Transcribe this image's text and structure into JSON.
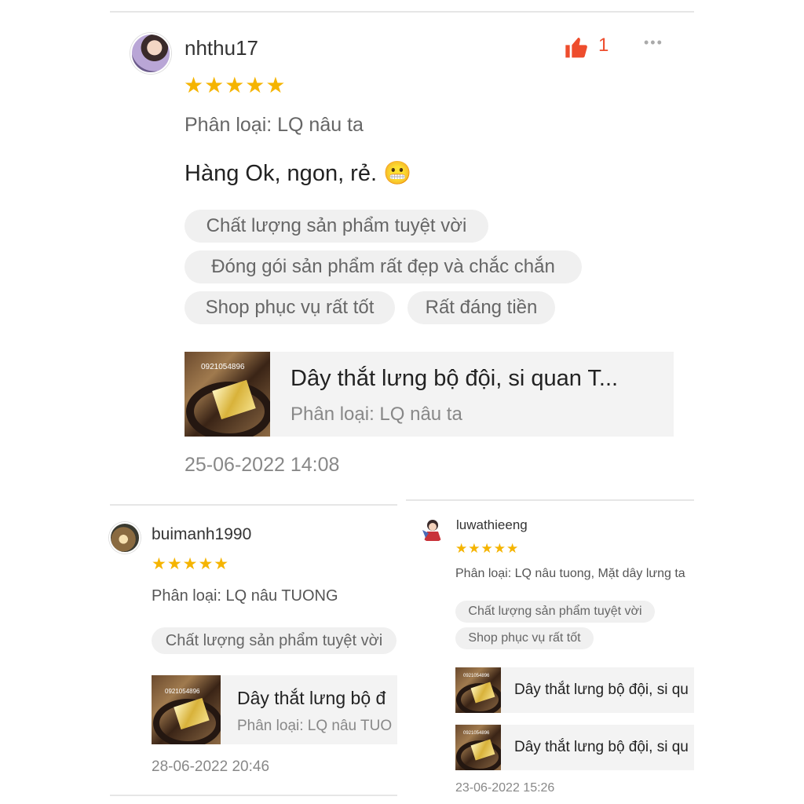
{
  "main_review": {
    "username": "nhthu17",
    "stars": "★★★★★",
    "like_count": "1",
    "more_icon": "•••",
    "variant": "Phân loại: LQ nâu ta",
    "comment": "Hàng Ok, ngon, rẻ.",
    "emoji": "😬",
    "tags": [
      "Chất lượng sản phẩm tuyệt vời",
      "Đóng gói sản phẩm rất đẹp và chắc chắn",
      "Shop phục vụ rất tốt",
      "Rất đáng tiền"
    ],
    "product_title": "Dây thắt lưng bộ đội, si quan T...",
    "product_variant": "Phân loại: LQ nâu ta",
    "thumb_watermark": "0921054896",
    "date": "25-06-2022 14:08"
  },
  "review_b": {
    "username": "buimanh1990",
    "stars": "★★★★★",
    "variant": "Phân loại: LQ nâu TUONG",
    "tags": [
      "Chất lượng sản phẩm tuyệt vời"
    ],
    "product_title": "Dây thắt lưng bộ đ",
    "product_variant": "Phân loại: LQ nâu TUO",
    "thumb_watermark": "0921054896",
    "date": "28-06-2022 20:46"
  },
  "review_c": {
    "username": "luwathieeng",
    "stars": "★★★★★",
    "variant": "Phân loại: LQ nâu tuong, Mặt dây lưng ta",
    "tags": [
      "Chất lượng sản phẩm tuyệt vời",
      "Shop phục vụ rất tốt"
    ],
    "products": [
      {
        "title": "Dây thắt lưng bộ đội, si qu",
        "watermark": "0921054896"
      },
      {
        "title": "Dây thắt lưng bộ đội, si qu",
        "watermark": "0921054896"
      }
    ],
    "date": "23-06-2022 15:26"
  },
  "colors": {
    "accent": "#ee4d2d",
    "star": "#f5b400",
    "chip_bg": "#f0f0f0"
  }
}
